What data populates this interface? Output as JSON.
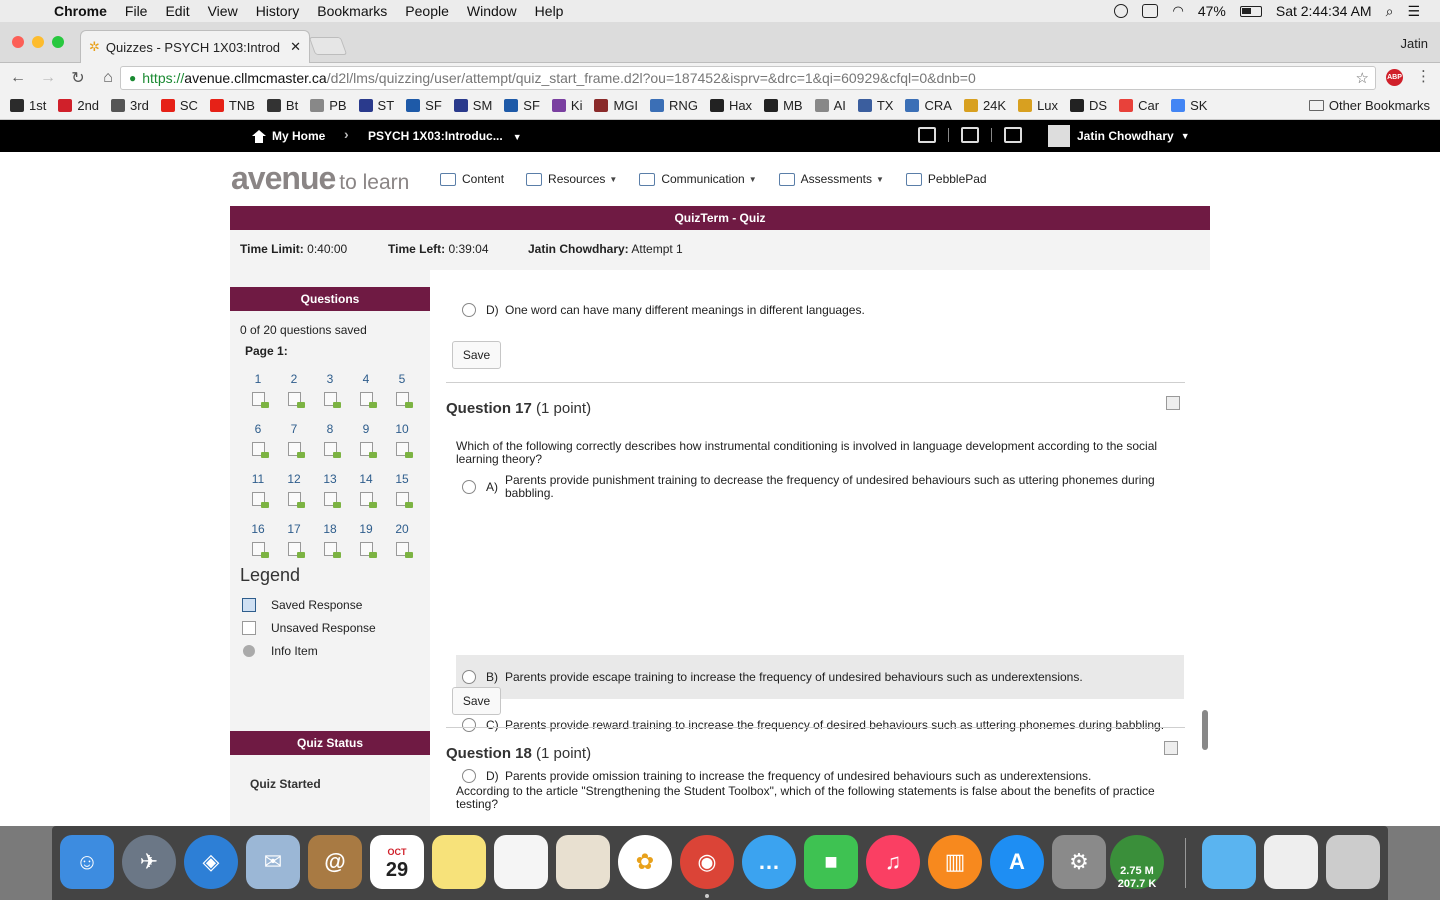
{
  "menubar": {
    "app": "Chrome",
    "items": [
      "File",
      "Edit",
      "View",
      "History",
      "Bookmarks",
      "People",
      "Window",
      "Help"
    ],
    "battery": "47%",
    "clock": "Sat 2:44:34 AM"
  },
  "browser": {
    "tab_title": "Quizzes - PSYCH 1X03:Introd",
    "profile": "Jatin",
    "url_scheme": "https://",
    "url_domain": "avenue.cllmcmaster.ca",
    "url_path": "/d2l/lms/quizzing/user/attempt/quiz_start_frame.d2l?ou=187452&isprv=&drc=1&qi=60929&cfql=0&dnb=0",
    "bookmarks": [
      {
        "label": "1st",
        "icon": "hl-icon",
        "color": "#2b2b2b"
      },
      {
        "label": "2nd",
        "icon": "hl-icon",
        "color": "#d0202a"
      },
      {
        "label": "3rd",
        "icon": "diamond-icon",
        "color": "#555555"
      },
      {
        "label": "SC",
        "icon": "youtube-icon",
        "color": "#e62117"
      },
      {
        "label": "TNB",
        "icon": "youtube-icon",
        "color": "#e62117"
      },
      {
        "label": "Bt",
        "icon": "rs-icon",
        "color": "#333333"
      },
      {
        "label": "PB",
        "icon": "page-icon",
        "color": "#888888"
      },
      {
        "label": "ST",
        "icon": "arrow-icon",
        "color": "#2a3a8c"
      },
      {
        "label": "SF",
        "icon": "circle-icon",
        "color": "#1e5aa8"
      },
      {
        "label": "SM",
        "icon": "arrow-icon",
        "color": "#2a3a8c"
      },
      {
        "label": "SF",
        "icon": "circle-icon",
        "color": "#1e5aa8"
      },
      {
        "label": "Ki",
        "icon": "ki-icon",
        "color": "#7a3fa0"
      },
      {
        "label": "MGI",
        "icon": "crown-icon",
        "color": "#8a2a2a"
      },
      {
        "label": "RNG",
        "icon": "gift-icon",
        "color": "#3b6fb6"
      },
      {
        "label": "Hax",
        "icon": "printer-icon",
        "color": "#222222"
      },
      {
        "label": "MB",
        "icon": "mb-icon",
        "color": "#222222"
      },
      {
        "label": "AI",
        "icon": "page-icon",
        "color": "#888888"
      },
      {
        "label": "TX",
        "icon": "tx-icon",
        "color": "#3b5e9e"
      },
      {
        "label": "CRA",
        "icon": "gift-icon",
        "color": "#3b6fb6"
      },
      {
        "label": "24K",
        "icon": "bag-icon",
        "color": "#d8a020"
      },
      {
        "label": "Lux",
        "icon": "bag-icon",
        "color": "#d8a020"
      },
      {
        "label": "DS",
        "icon": "ds-icon",
        "color": "#222222"
      },
      {
        "label": "Car",
        "icon": "ag-icon",
        "color": "#e8413a"
      },
      {
        "label": "SK",
        "icon": "google-icon",
        "color": "#4285f4"
      }
    ],
    "other_bookmarks": "Other Bookmarks"
  },
  "d2l": {
    "home": "My Home",
    "course": "PSYCH 1X03:Introduc...",
    "user": "Jatin Chowdhary",
    "logo_main": "avenue",
    "logo_sub": "to learn",
    "nav": [
      "Content",
      "Resources",
      "Communication",
      "Assessments",
      "PebblePad"
    ]
  },
  "quiz": {
    "title": "QuizTerm - Quiz",
    "time_limit_label": "Time Limit:",
    "time_limit": "0:40:00",
    "time_left_label": "Time Left:",
    "time_left": "0:39:04",
    "attempt_user": "Jatin Chowdhary:",
    "attempt": "Attempt 1"
  },
  "sidebar": {
    "questions_header": "Questions",
    "saved_count": "0 of 20 questions saved",
    "page_label": "Page 1:",
    "question_numbers": [
      "1",
      "2",
      "3",
      "4",
      "5",
      "6",
      "7",
      "8",
      "9",
      "10",
      "11",
      "12",
      "13",
      "14",
      "15",
      "16",
      "17",
      "18",
      "19",
      "20"
    ],
    "legend_title": "Legend",
    "legend": [
      "Saved Response",
      "Unsaved Response",
      "Info Item"
    ],
    "status_header": "Quiz Status",
    "status": "Quiz Started"
  },
  "main": {
    "prev_option": {
      "letter": "D)",
      "text": "One word can have many different meanings in different languages."
    },
    "save_label": "Save",
    "q17": {
      "title": "Question 17",
      "points": "(1 point)",
      "text": "Which of the following correctly describes how instrumental conditioning is involved in language development according to the social learning theory?",
      "options": [
        {
          "letter": "A)",
          "text": "Parents provide punishment training to decrease the frequency of undesired behaviours such as uttering phonemes during babbling."
        },
        {
          "letter": "B)",
          "text": "Parents provide escape training to increase the frequency of undesired behaviours such as underextensions."
        },
        {
          "letter": "C)",
          "text": "Parents provide reward training to increase the frequency of desired behaviours such as uttering phonemes during babbling."
        },
        {
          "letter": "D)",
          "text": "Parents provide omission training to increase the frequency of undesired behaviours such as underextensions."
        }
      ]
    },
    "q18": {
      "title": "Question 18",
      "points": "(1 point)",
      "text": "According to the article \"Strengthening the Student Toolbox\", which of the following statements is false about the benefits of practice testing?"
    }
  },
  "dock": {
    "calendar_month": "OCT",
    "calendar_day": "29",
    "net_up": "2.75 M",
    "net_down": "207.7 K"
  },
  "colors": {
    "quiz_header": "#6f1a43",
    "link": "#2e5d8c"
  }
}
